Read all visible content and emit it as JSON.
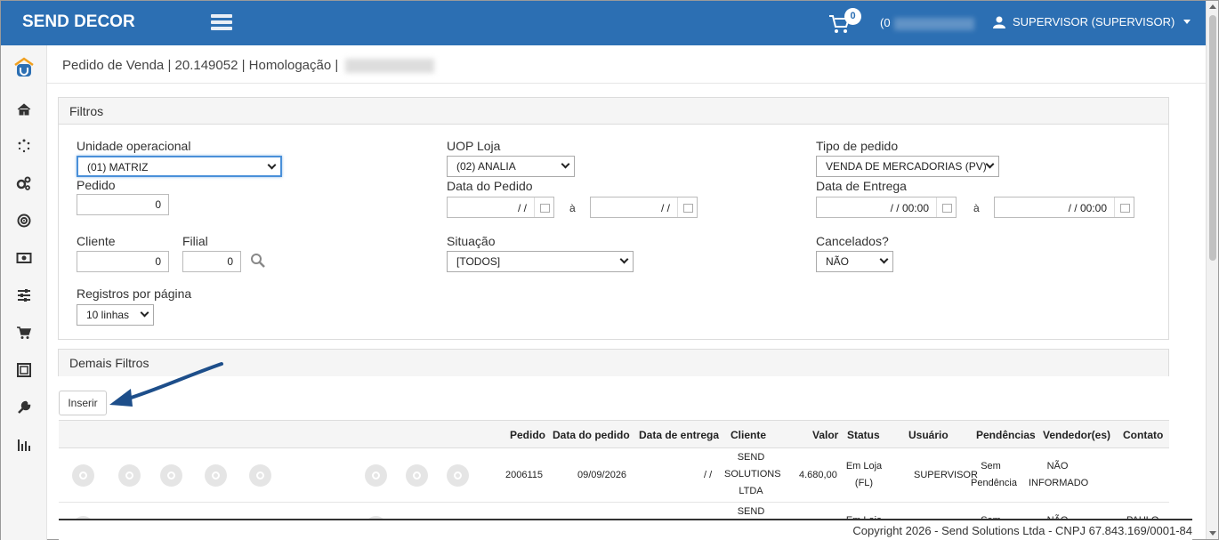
{
  "topbar": {
    "brand": "SEND DECOR",
    "cart_count": "0",
    "phone_prefix": "(0",
    "user_label": "SUPERVISOR (SUPERVISOR)"
  },
  "sidebar": {
    "icons": [
      "logo-icon",
      "home-icon",
      "spinner-icon",
      "cogs-icon",
      "target-icon",
      "money-icon",
      "sliders-icon",
      "cart-icon",
      "frame-icon",
      "wrench-icon",
      "bar-chart-icon"
    ]
  },
  "breadcrumb": {
    "text": "Pedido de Venda | 20.149052 | Homologação |"
  },
  "filtros": {
    "title": "Filtros",
    "unidade_label": "Unidade operacional",
    "unidade_value": "(01) MATRIZ",
    "uop_label": "UOP Loja",
    "uop_value": "(02) ANALIA",
    "tipo_label": "Tipo de pedido",
    "tipo_value": "VENDA DE MERCADORIAS (PV)",
    "pedido_label": "Pedido",
    "pedido_value": "0",
    "data_pedido_label": "Data do Pedido",
    "date_empty": "/  /",
    "date_time": "/  /      00:00",
    "ate": "à",
    "data_entrega_label": "Data de Entrega",
    "cliente_label": "Cliente",
    "cliente_value": "0",
    "filial_label": "Filial",
    "filial_value": "0",
    "situacao_label": "Situação",
    "situacao_value": "[TODOS]",
    "cancelados_label": "Cancelados?",
    "cancelados_value": "NÃO",
    "registros_label": "Registros por página",
    "registros_value": "10 linhas"
  },
  "demais": {
    "title": "Demais Filtros"
  },
  "insert_button": "Inserir",
  "table": {
    "headers": [
      "Pedido",
      "Data do pedido",
      "Data de entrega",
      "Cliente",
      "Valor",
      "Status",
      "Usuário",
      "Pendências",
      "Vendedor(es)",
      "Contato"
    ],
    "rows": [
      {
        "pedido": "2006115",
        "data_pedido": "09/09/2026",
        "data_entrega": "/ /",
        "cliente": [
          "SEND",
          "SOLUTIONS",
          "LTDA"
        ],
        "valor": "4.680,00",
        "status": [
          "Em Loja",
          "(FL)"
        ],
        "usuario": "SUPERVISOR",
        "pendencias": [
          "Sem",
          "Pendência"
        ],
        "vendedor": [
          "NÃO",
          "INFORMADO"
        ],
        "contato": ""
      },
      {
        "pedido": "",
        "data_pedido": "",
        "data_entrega": "",
        "cliente": [
          "SEND"
        ],
        "valor": "",
        "status": [
          "Em Loja"
        ],
        "usuario": "",
        "pendencias": [
          "Sem"
        ],
        "vendedor": [
          "NÃO"
        ],
        "contato": "PAULO"
      }
    ]
  },
  "footer": {
    "copyright": "Copyright 2026 - Send Solutions Ltda - CNPJ 67.843.169/0001-84"
  }
}
